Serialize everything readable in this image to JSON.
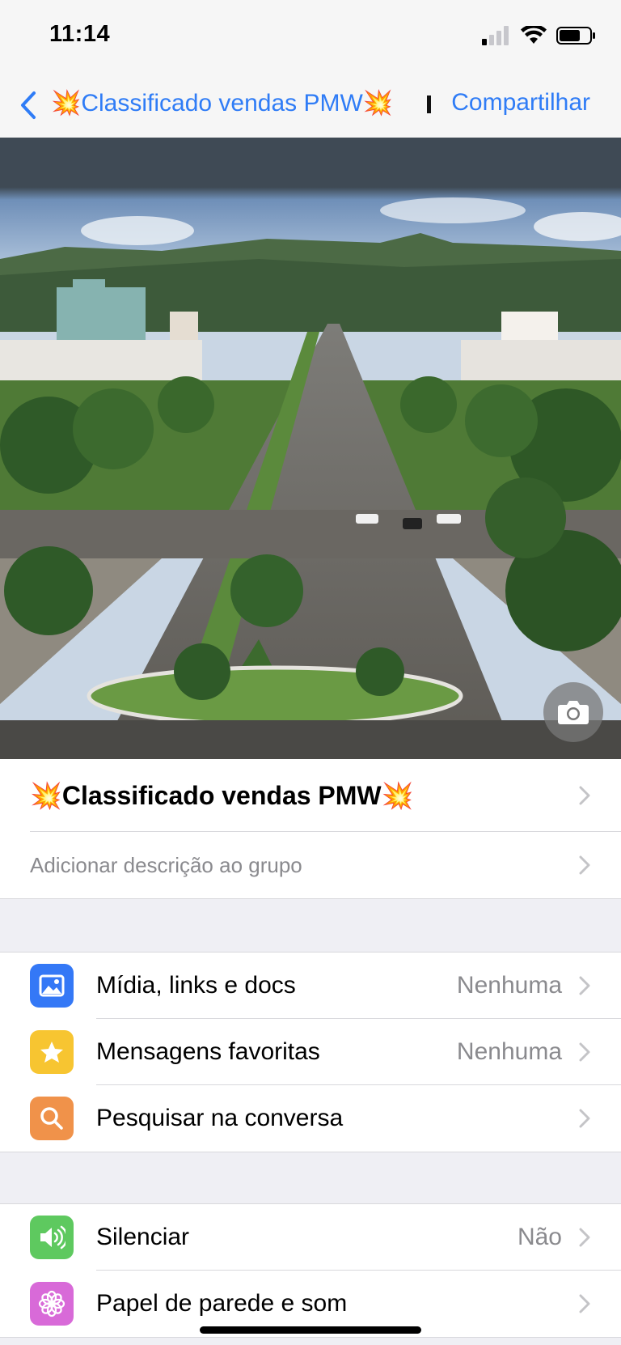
{
  "status_bar": {
    "time": "11:14"
  },
  "nav": {
    "back_icon": "chevron-left-icon",
    "title": "💥Classificado vendas PMW💥",
    "share_label": "Compartilhar",
    "accent_color": "#2f7cf6"
  },
  "hero": {
    "camera_icon": "camera-icon"
  },
  "group": {
    "name": "💥Classificado vendas PMW💥",
    "description_placeholder": "Adicionar descrição ao grupo"
  },
  "section1": {
    "items": [
      {
        "icon": "photo-icon",
        "icon_color": "#3478f6",
        "label": "Mídia, links e docs",
        "value": "Nenhuma"
      },
      {
        "icon": "star-icon",
        "icon_color": "#f7c531",
        "label": "Mensagens favoritas",
        "value": "Nenhuma"
      },
      {
        "icon": "search-icon",
        "icon_color": "#f0924a",
        "label": "Pesquisar na conversa",
        "value": ""
      }
    ]
  },
  "section2": {
    "items": [
      {
        "icon": "speaker-icon",
        "icon_color": "#5ec95f",
        "label": "Silenciar",
        "value": "Não"
      },
      {
        "icon": "flower-icon",
        "icon_color": "#d86ad8",
        "label": "Papel de parede e som",
        "value": ""
      }
    ]
  }
}
